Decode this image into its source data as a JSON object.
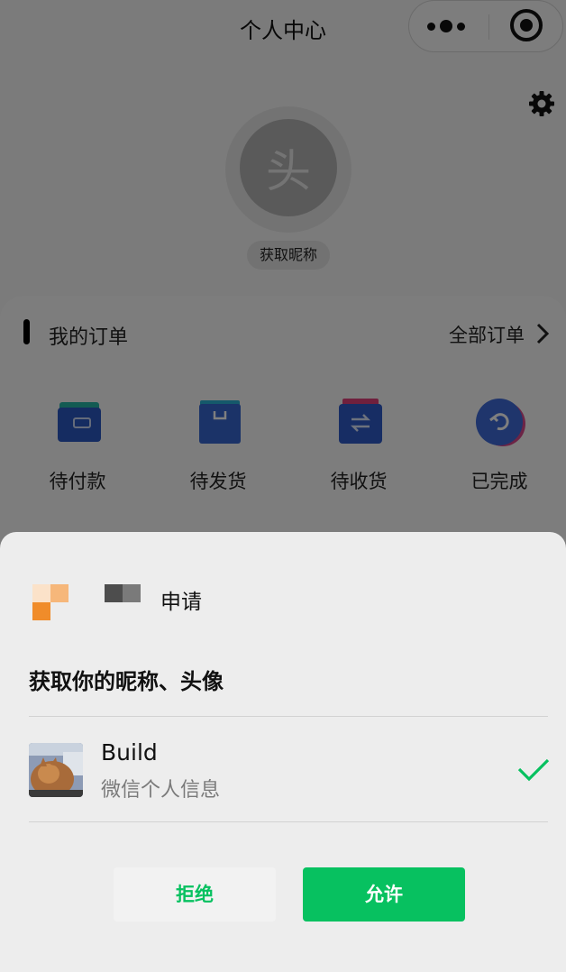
{
  "navbar": {
    "title": "个人中心"
  },
  "profile": {
    "avatar_text": "头",
    "nickname_button": "获取昵称"
  },
  "orders": {
    "title": "我的订单",
    "all_label": "全部订单",
    "items": [
      {
        "label": "待付款",
        "icon": "wallet-icon",
        "color": "#2b59c3"
      },
      {
        "label": "待发货",
        "icon": "package-icon",
        "color": "#3766d1"
      },
      {
        "label": "待收货",
        "icon": "exchange-icon",
        "color": "#2f5bc9"
      },
      {
        "label": "已完成",
        "icon": "refresh-circle-icon",
        "color": "#3f6ad8"
      }
    ]
  },
  "auth_sheet": {
    "apply_text": "申请",
    "permission_title": "获取你的昵称、头像",
    "user": {
      "name": "Build",
      "subtitle": "微信个人信息"
    },
    "reject_label": "拒绝",
    "allow_label": "允许"
  },
  "colors": {
    "wechat_green": "#07c160",
    "logo_orange": "#f08c2a",
    "logo_peach": "#f6b77a",
    "logo_light": "#fbe2c9"
  }
}
